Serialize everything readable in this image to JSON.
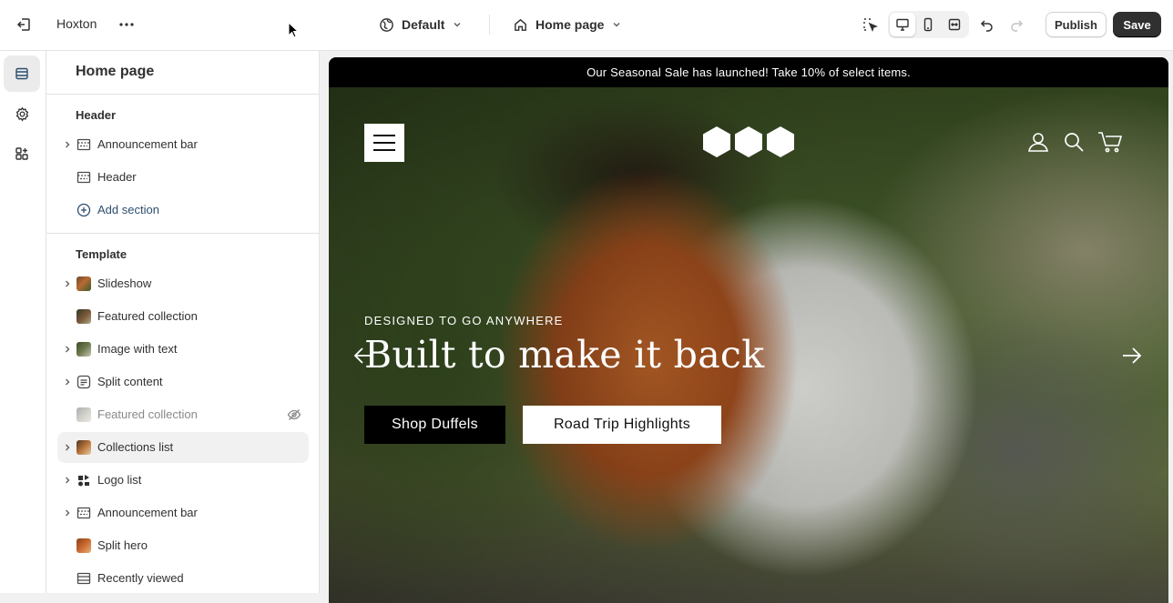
{
  "topbar": {
    "store_name": "Hoxton",
    "theme_label": "Default",
    "page_label": "Home page",
    "publish_label": "Publish",
    "save_label": "Save",
    "icons": [
      "exit-icon",
      "more-icon",
      "theme-icon",
      "home-icon",
      "inspector-icon",
      "desktop-icon",
      "mobile-icon",
      "fullscreen-icon",
      "undo-icon",
      "redo-icon"
    ]
  },
  "rail": {
    "items": [
      {
        "name": "sections",
        "icon": "sections-icon",
        "active": true
      },
      {
        "name": "theme-settings",
        "icon": "gear-icon",
        "active": false
      },
      {
        "name": "apps",
        "icon": "apps-icon",
        "active": false
      }
    ]
  },
  "sidebar": {
    "title": "Home page",
    "header_group": {
      "label": "Header",
      "items": [
        {
          "label": "Announcement bar",
          "expandable": true,
          "icon": "section-icon"
        },
        {
          "label": "Header",
          "expandable": false,
          "icon": "section-icon"
        }
      ],
      "add_label": "Add section"
    },
    "template_group": {
      "label": "Template",
      "items": [
        {
          "label": "Slideshow",
          "expandable": true,
          "icon": "image-thumb"
        },
        {
          "label": "Featured collection",
          "expandable": false,
          "icon": "image-thumb"
        },
        {
          "label": "Image with text",
          "expandable": true,
          "icon": "image-thumb"
        },
        {
          "label": "Split content",
          "expandable": true,
          "icon": "text-section-icon"
        },
        {
          "label": "Featured collection",
          "expandable": false,
          "icon": "image-thumb",
          "hidden": true
        },
        {
          "label": "Collections list",
          "expandable": true,
          "icon": "image-thumb",
          "hovered": true
        },
        {
          "label": "Logo list",
          "expandable": true,
          "icon": "logo-thumb"
        },
        {
          "label": "Announcement bar",
          "expandable": true,
          "icon": "section-icon"
        },
        {
          "label": "Split hero",
          "expandable": false,
          "icon": "image-thumb"
        },
        {
          "label": "Recently viewed",
          "expandable": false,
          "icon": "section-icon"
        }
      ]
    }
  },
  "preview": {
    "announcement": "Our Seasonal Sale has launched! Take 10% of select items.",
    "eyebrow": "DESIGNED TO GO ANYWHERE",
    "headline": "Built to make it back",
    "cta_primary": "Shop Duffels",
    "cta_secondary": "Road Trip Highlights"
  },
  "colors": {
    "accent_dark": "#303030",
    "announcement_bg": "#000000",
    "backpack": "#b85a22"
  }
}
